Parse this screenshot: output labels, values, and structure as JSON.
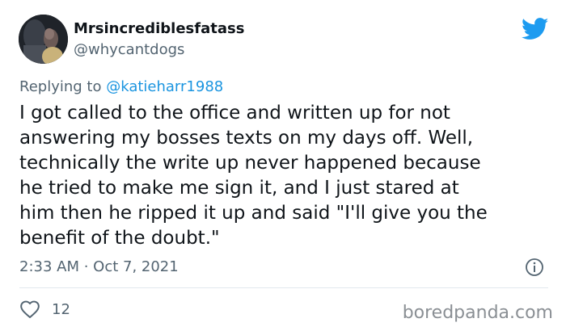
{
  "user": {
    "display_name": "Mrsincrediblesfatass",
    "handle": "@whycantdogs",
    "avatar": "avatar-photo"
  },
  "reply": {
    "prefix": "Replying to",
    "mention": "@katieharr1988"
  },
  "tweet": {
    "text": "I got called to the office and written up for not\nanswering my bosses texts on my days off. Well,\ntechnically the write up never happened because\nhe tried to make me sign it, and I just stared at\nhim then he ripped it up and said \"I'll give you the\nbenefit of the doubt.\"",
    "timestamp": "2:33 AM · Oct 7, 2021"
  },
  "actions": {
    "like_count": "12",
    "like_icon": "heart-icon"
  },
  "icons": {
    "brand": "twitter-bird-icon",
    "info": "info-icon"
  },
  "watermark": "boredpanda.com",
  "colors": {
    "brand_blue": "#1d9bf0",
    "mention_blue": "#1b95e0",
    "secondary_text": "#536471",
    "primary_text": "#0f1419",
    "watermark_gray": "#8a8f94"
  }
}
